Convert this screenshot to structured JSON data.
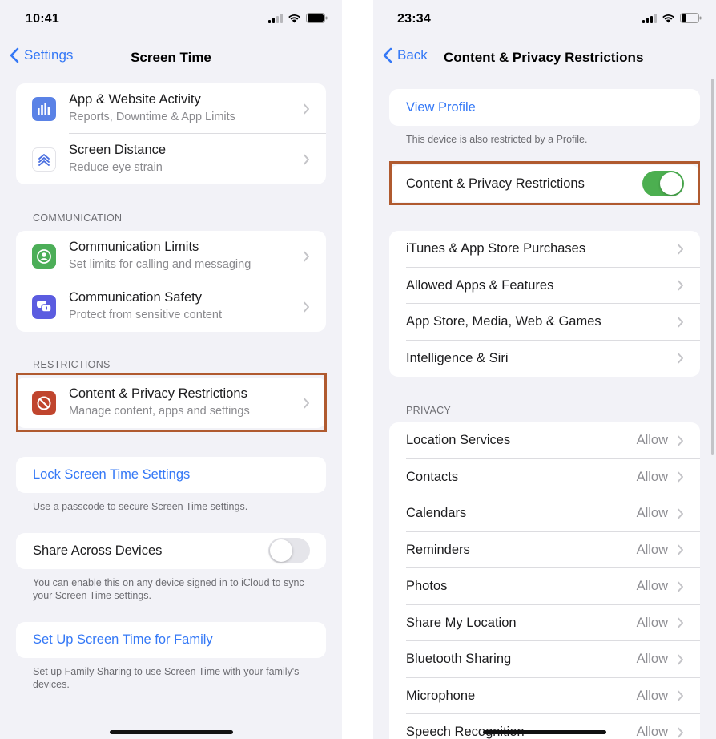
{
  "colors": {
    "accent": "#3478f6",
    "toggle_on": "#4caf50",
    "highlight": "#b05a2f"
  },
  "left": {
    "status_time": "10:41",
    "back_label": "Settings",
    "title": "Screen Time",
    "items": [
      {
        "title": "App & Website Activity",
        "subtitle": "Reports, Downtime & App Limits",
        "icon": "bar-chart-icon",
        "icon_color": "#5a82e6"
      },
      {
        "title": "Screen Distance",
        "subtitle": "Reduce eye strain",
        "icon": "chevrons-up-icon",
        "icon_color": "#ffffff"
      }
    ],
    "communication_header": "COMMUNICATION",
    "communication": [
      {
        "title": "Communication Limits",
        "subtitle": "Set limits for calling and messaging",
        "icon": "person-circle-icon",
        "icon_color": "#4cae58"
      },
      {
        "title": "Communication Safety",
        "subtitle": "Protect from sensitive content",
        "icon": "chat-bubbles-icon",
        "icon_color": "#5b5ce0"
      }
    ],
    "restrictions_header": "RESTRICTIONS",
    "restrictions": [
      {
        "title": "Content & Privacy Restrictions",
        "subtitle": "Manage content, apps and settings",
        "icon": "no-entry-icon",
        "icon_color": "#c0452e"
      }
    ],
    "lock_label": "Lock Screen Time Settings",
    "lock_footnote": "Use a passcode to secure Screen Time settings.",
    "share_label": "Share Across Devices",
    "share_enabled": false,
    "share_footnote": "You can enable this on any device signed in to iCloud to sync your Screen Time settings.",
    "family_label": "Set Up Screen Time for Family",
    "family_footnote": "Set up Family Sharing to use Screen Time with your family's devices."
  },
  "right": {
    "status_time": "23:34",
    "back_label": "Back",
    "title": "Content & Privacy Restrictions",
    "view_profile_label": "View Profile",
    "profile_footnote": "This device is also restricted by a Profile.",
    "main_toggle_label": "Content & Privacy Restrictions",
    "main_toggle_enabled": true,
    "store_items": [
      "iTunes & App Store Purchases",
      "Allowed Apps & Features",
      "App Store, Media, Web & Games",
      "Intelligence & Siri"
    ],
    "privacy_header": "PRIVACY",
    "privacy_items": [
      {
        "label": "Location Services",
        "value": "Allow"
      },
      {
        "label": "Contacts",
        "value": "Allow"
      },
      {
        "label": "Calendars",
        "value": "Allow"
      },
      {
        "label": "Reminders",
        "value": "Allow"
      },
      {
        "label": "Photos",
        "value": "Allow"
      },
      {
        "label": "Share My Location",
        "value": "Allow"
      },
      {
        "label": "Bluetooth Sharing",
        "value": "Allow"
      },
      {
        "label": "Microphone",
        "value": "Allow"
      },
      {
        "label": "Speech Recognition",
        "value": "Allow"
      }
    ]
  }
}
